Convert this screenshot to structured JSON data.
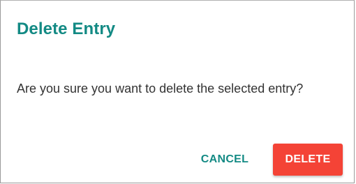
{
  "dialog": {
    "title": "Delete Entry",
    "message": "Are you sure you want to delete the selected entry?",
    "cancel_label": "CANCEL",
    "delete_label": "DELETE"
  },
  "colors": {
    "title": "#138a84",
    "cancel_text": "#138a84",
    "delete_background": "#f44336",
    "delete_text": "#ffffff",
    "message_text": "#333333"
  }
}
